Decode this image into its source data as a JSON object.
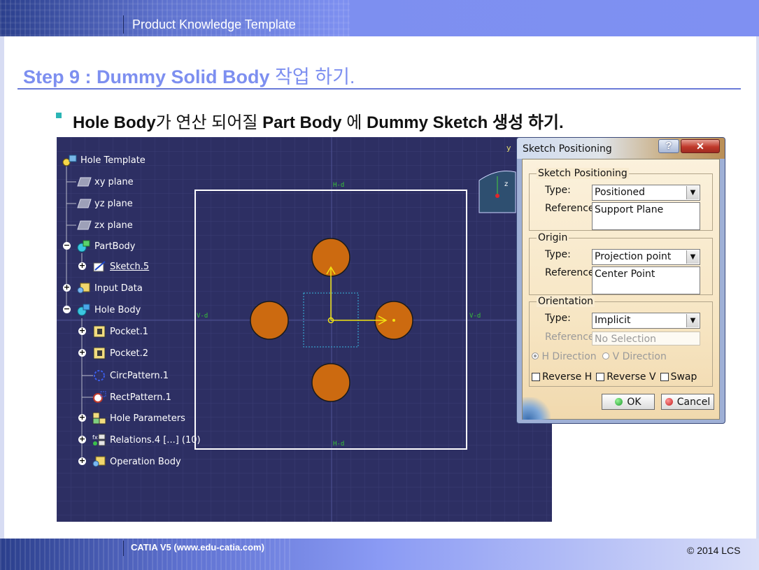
{
  "slide": {
    "header_title": "Product Knowledge Template",
    "step_title_prefix": "Step 9 : Dummy Solid Body",
    "step_title_korean": "작업 하기.",
    "bullet": {
      "b1": "Hole Body",
      "t1": "가 연산 되어질 ",
      "b2": "Part Body",
      "t2": " 에 ",
      "b3": "Dummy Sketch",
      "t3": " 생성 하기."
    },
    "footer_left": "CATIA V5 (www.edu-catia.com)",
    "footer_right": "© 2014 LCS"
  },
  "colors": {
    "accent_blue": "#7d8ff0",
    "viewport_bg": "#2d2f63",
    "hole_fill": "#cc6a10",
    "bullet_mark": "#2bb5b5"
  },
  "tree": {
    "root": "Hole Template",
    "items": [
      {
        "label": "xy plane",
        "icon": "plane-icon"
      },
      {
        "label": "yz plane",
        "icon": "plane-icon"
      },
      {
        "label": "zx plane",
        "icon": "plane-icon"
      },
      {
        "label": "PartBody",
        "icon": "body-icon"
      },
      {
        "label": "Sketch.5",
        "icon": "sketch-icon"
      },
      {
        "label": "Input Data",
        "icon": "input-data-icon"
      },
      {
        "label": "Hole Body",
        "icon": "body-icon"
      },
      {
        "label": "Pocket.1",
        "icon": "pocket-icon"
      },
      {
        "label": "Pocket.2",
        "icon": "pocket-icon"
      },
      {
        "label": "CircPattern.1",
        "icon": "circ-pattern-icon"
      },
      {
        "label": "RectPattern.1",
        "icon": "rect-pattern-icon"
      },
      {
        "label": "Hole Parameters",
        "icon": "parameters-icon"
      },
      {
        "label": "Relations.4 [...] (10)",
        "icon": "relations-icon"
      },
      {
        "label": "Operation Body",
        "icon": "operation-body-icon"
      }
    ]
  },
  "viewport": {
    "axis_h_left": "V-d",
    "axis_h_right": "V-d",
    "axis_v_top": "H-d",
    "axis_v_bottom": "H-d",
    "compass_y": "y",
    "compass_z": "z"
  },
  "dialog": {
    "title": "Sketch Positioning",
    "help_label": "?",
    "close_label": "✕",
    "group_positioning": {
      "label": "Sketch Positioning",
      "type_label": "Type:",
      "type_value": "Positioned",
      "reference_label": "Reference:",
      "reference_value": "Support Plane"
    },
    "group_origin": {
      "label": "Origin",
      "type_label": "Type:",
      "type_value": "Projection point",
      "reference_label": "Reference:",
      "reference_value": "Center Point"
    },
    "group_orientation": {
      "label": "Orientation",
      "type_label": "Type:",
      "type_value": "Implicit",
      "reference_label": "Reference:",
      "reference_value": "No Selection",
      "h_direction": "H Direction",
      "v_direction": "V Direction",
      "reverse_h": "Reverse H",
      "reverse_v": "Reverse V",
      "swap": "Swap"
    },
    "ok_label": "OK",
    "cancel_label": "Cancel"
  }
}
